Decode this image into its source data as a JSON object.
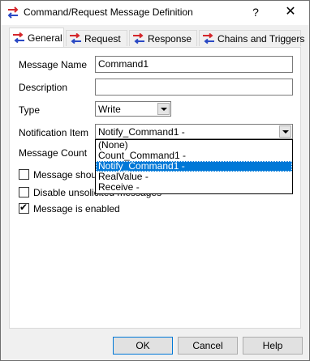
{
  "window": {
    "title": "Command/Request Message Definition",
    "help": "?",
    "close": "✕"
  },
  "tabs": [
    {
      "label": "General"
    },
    {
      "label": "Request"
    },
    {
      "label": "Response"
    },
    {
      "label": "Chains and Triggers"
    }
  ],
  "form": {
    "message_name_label": "Message Name",
    "message_name_value": "Command1",
    "description_label": "Description",
    "description_value": "",
    "type_label": "Type",
    "type_value": "Write",
    "notification_label": "Notification Item",
    "notification_value": "Notify_Command1 -",
    "message_count_label": "Message Count"
  },
  "dropdown": {
    "options": [
      "(None)",
      "Count_Command1 -",
      "Notify_Command1 -",
      "RealValue -",
      "Receive -"
    ],
    "selected_index": 2
  },
  "checkboxes": [
    {
      "label": "Message should",
      "checked": false
    },
    {
      "label": "Disable unsolicited messages",
      "checked": false
    },
    {
      "label": "Message is enabled",
      "checked": true
    }
  ],
  "buttons": {
    "ok": "OK",
    "cancel": "Cancel",
    "help": "Help"
  },
  "colors": {
    "selection": "#0078d7",
    "icon_red": "#d4262b",
    "icon_blue": "#2a49c4"
  }
}
